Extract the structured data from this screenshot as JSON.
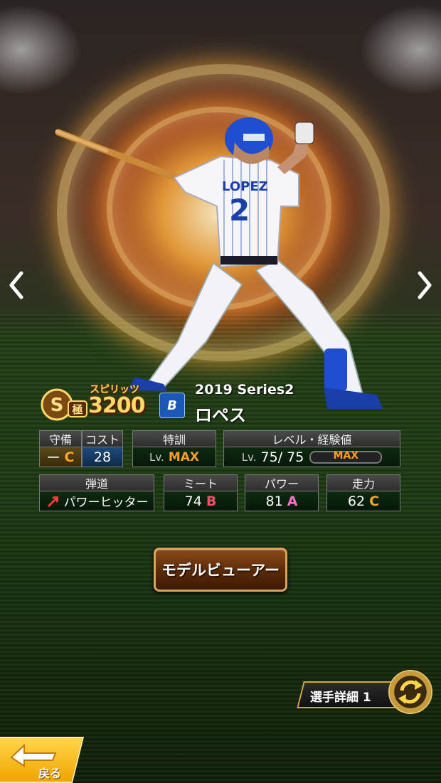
{
  "card": {
    "series": "2019 Series2",
    "player_name": "ロペス",
    "spirit_label": "スピリッツ",
    "spirit_value": "3200",
    "team_logo_text": "B",
    "rank_icon": "s-kiwami-rank-icon"
  },
  "stats": {
    "defense": {
      "label": "守備",
      "value": "ー",
      "grade": "C"
    },
    "cost": {
      "label": "コスト",
      "value": "28"
    },
    "training": {
      "label": "特訓",
      "lv_prefix": "Lv.",
      "value": "MAX"
    },
    "level": {
      "label": "レベル・経験値",
      "lv_prefix": "Lv.",
      "current": "75/",
      "max": "75",
      "exp_bar_label": "MAX",
      "exp_fraction": 1.0
    },
    "trajectory": {
      "label": "弾道",
      "value": "パワーヒッター",
      "icon": "up-right-arrow-icon"
    },
    "meet": {
      "label": "ミート",
      "value": "74",
      "grade": "B"
    },
    "power": {
      "label": "パワー",
      "value": "81",
      "grade": "A"
    },
    "speed": {
      "label": "走力",
      "value": "62",
      "grade": "C"
    }
  },
  "buttons": {
    "model_viewer": "モデルビューアー",
    "player_detail": "選手詳細 1",
    "back": "戻る"
  },
  "colors": {
    "accent_orange": "#ff9d2a",
    "grade_b": "#ff4f6a",
    "grade_a": "#ff70c9",
    "grade_c": "#ffa52a",
    "back_yellow": "#f0a500"
  }
}
